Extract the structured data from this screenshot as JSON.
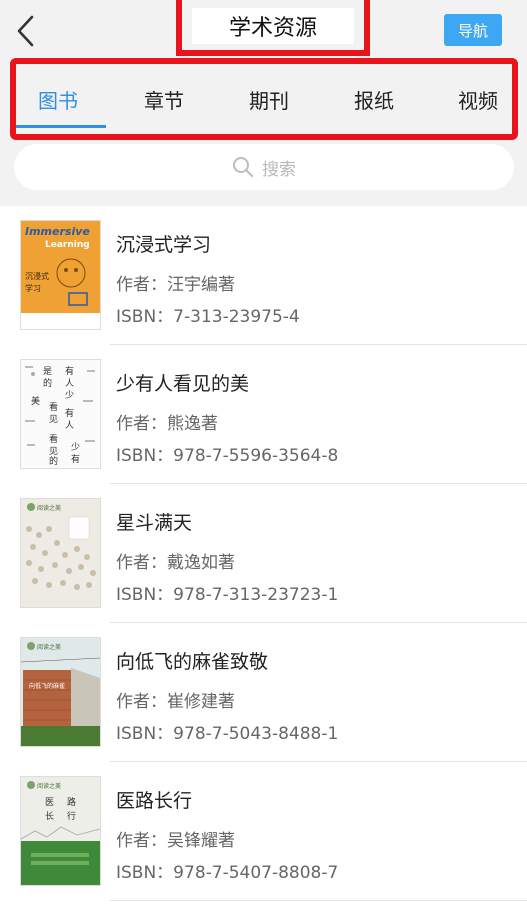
{
  "header": {
    "title": "学术资源",
    "nav_label": "导航"
  },
  "tabs": [
    {
      "label": "图书",
      "active": true
    },
    {
      "label": "章节",
      "active": false
    },
    {
      "label": "期刊",
      "active": false
    },
    {
      "label": "报纸",
      "active": false
    },
    {
      "label": "视频",
      "active": false
    }
  ],
  "search": {
    "placeholder": "搜索"
  },
  "colors": {
    "accent": "#2f8ee6",
    "nav_button": "#3da7f3",
    "highlight_box": "#e8141b"
  },
  "books": [
    {
      "title": "沉浸式学习",
      "author": "作者：汪宇编著",
      "isbn": "ISBN：7-313-23975-4",
      "cover_text": "Immersive Learning",
      "cover_subtitle": "沉浸式学习"
    },
    {
      "title": "少有人看见的美",
      "author": "作者：熊逸著",
      "isbn": "ISBN：978-7-5596-3564-8",
      "cover_text": "少有人看见的美"
    },
    {
      "title": "星斗满天",
      "author": "作者：戴逸如著",
      "isbn": "ISBN：978-7-313-23723-1",
      "cover_text": "阅读之美"
    },
    {
      "title": "向低飞的麻雀致敬",
      "author": "作者：崔修建著",
      "isbn": "ISBN：978-7-5043-8488-1",
      "cover_text": "阅读之美"
    },
    {
      "title": "医路长行",
      "author": "作者：吴锋耀著",
      "isbn": "ISBN：978-7-5407-8808-7",
      "cover_text": "阅读之美",
      "cover_subtitle": "医路长行"
    }
  ]
}
